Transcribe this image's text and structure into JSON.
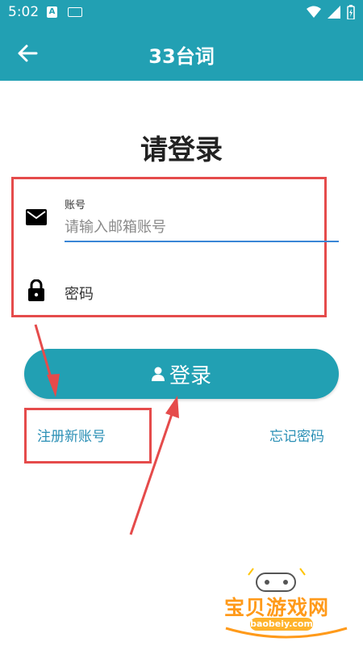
{
  "status_bar": {
    "time": "5:02",
    "a_icon": "A"
  },
  "app_bar": {
    "title": "33台词"
  },
  "page": {
    "title": "请登录"
  },
  "account": {
    "label": "账号",
    "placeholder": "请输入邮箱账号"
  },
  "password": {
    "placeholder": "密码"
  },
  "login_button": {
    "label": "登录"
  },
  "links": {
    "register": "注册新账号",
    "forgot": "忘记密码"
  },
  "watermark": {
    "text": "宝贝游戏网",
    "url": "baobeiy.com"
  },
  "colors": {
    "primary": "#22a0b3",
    "link": "#2a8fb5",
    "annotation": "#e54b4b",
    "underline": "#3a86d6",
    "watermark": "#ff9a1a"
  }
}
